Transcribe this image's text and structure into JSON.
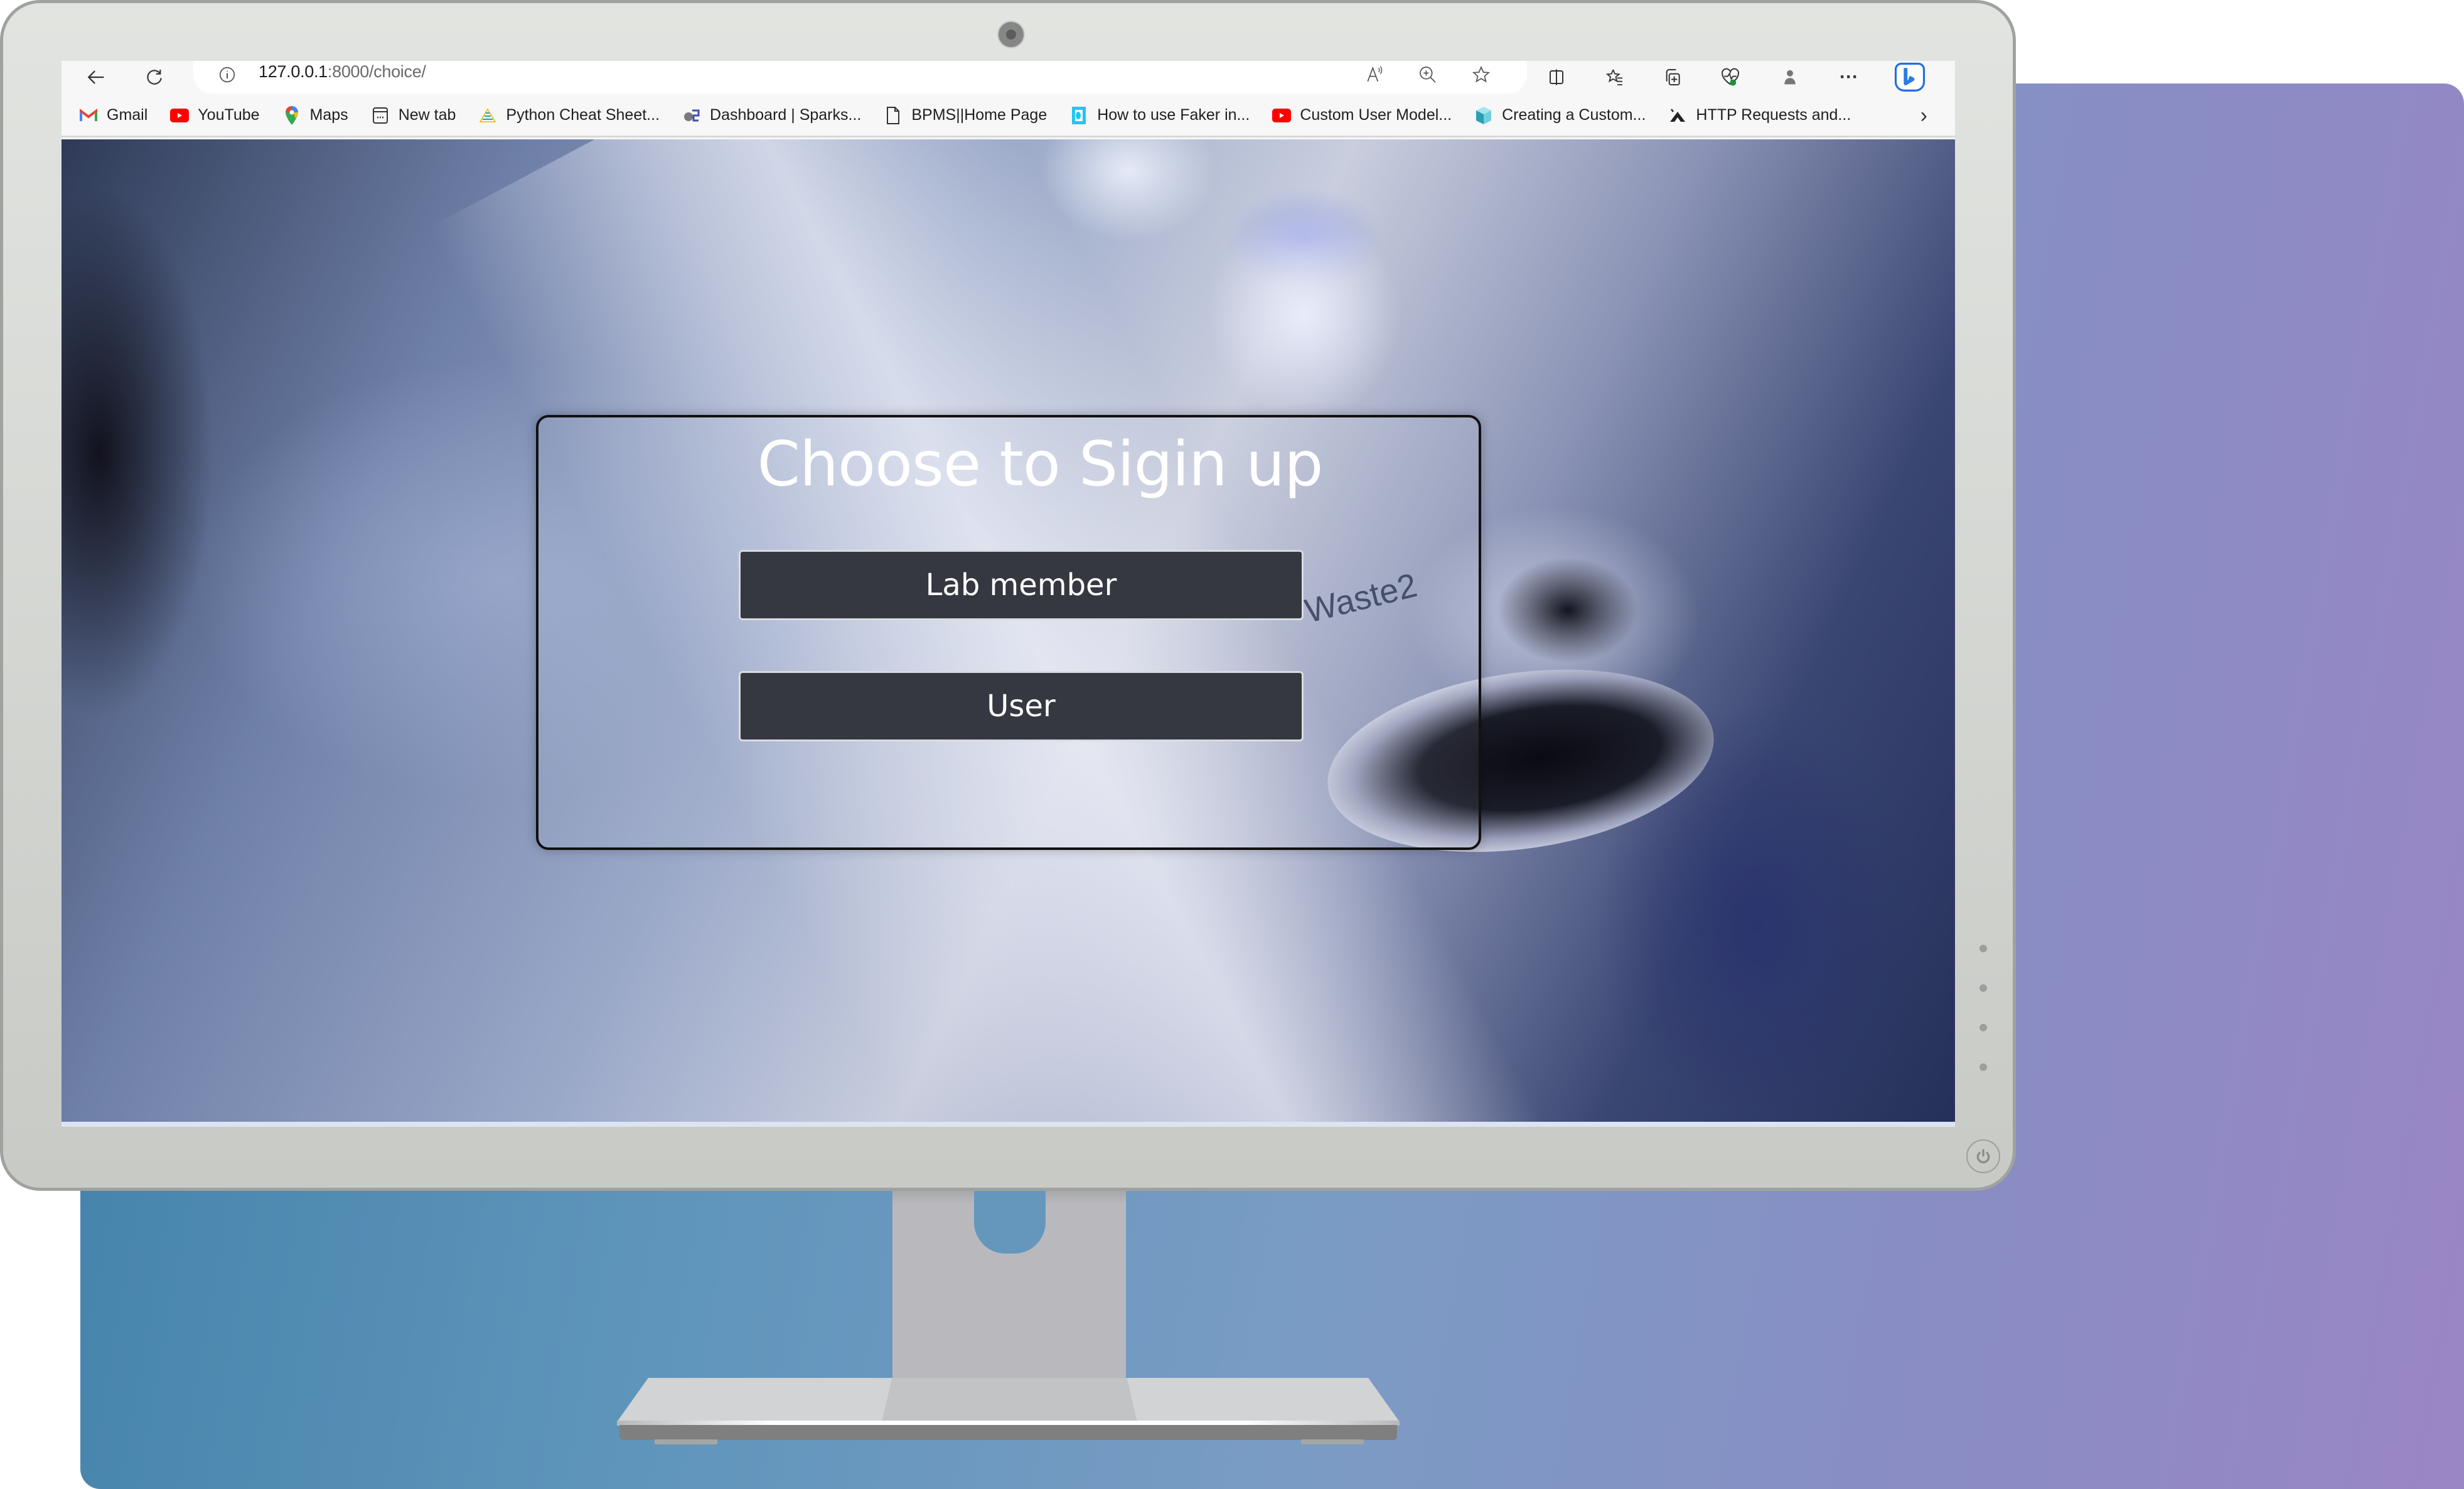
{
  "browser": {
    "url_host": "127.0.0.1",
    "url_path": ":8000/choice/",
    "nav": {
      "back_icon": "arrow-left-icon",
      "refresh_icon": "refresh-icon",
      "site_info_icon": "info-icon"
    },
    "address_bar_icons": [
      "read-aloud-icon",
      "zoom-icon",
      "favorite-star-icon"
    ],
    "toolbar_icons": [
      "split-screen-icon",
      "favorites-icon",
      "collections-icon",
      "browser-essentials-icon",
      "profile-icon",
      "more-icon",
      "copilot-icon"
    ],
    "more_label": "···",
    "bookmarks": [
      {
        "label": "Gmail",
        "icon": "gmail-icon"
      },
      {
        "label": "YouTube",
        "icon": "youtube-icon"
      },
      {
        "label": "Maps",
        "icon": "maps-icon"
      },
      {
        "label": "New tab",
        "icon": "new-tab-icon"
      },
      {
        "label": "Python Cheat Sheet...",
        "icon": "python-cheatsheet-icon"
      },
      {
        "label": "Dashboard | Sparks...",
        "icon": "dashboard-icon"
      },
      {
        "label": "BPMS||Home Page",
        "icon": "page-icon"
      },
      {
        "label": "How to use Faker in...",
        "icon": "faker-icon"
      },
      {
        "label": "Custom User Model...",
        "icon": "youtube-icon"
      },
      {
        "label": "Creating a Custom...",
        "icon": "cube-icon"
      },
      {
        "label": "HTTP Requests and...",
        "icon": "http-icon"
      }
    ],
    "bookmarks_overflow": "›"
  },
  "page": {
    "background_label": "Waste2",
    "card": {
      "title": "Choose to Sigin up",
      "buttons": [
        {
          "label": "Lab member"
        },
        {
          "label": "User"
        }
      ]
    }
  },
  "colors": {
    "button_bg": "#353841",
    "button_border": "#d9dbe0",
    "title_color": "#ffffff",
    "card_border": "#111111"
  }
}
